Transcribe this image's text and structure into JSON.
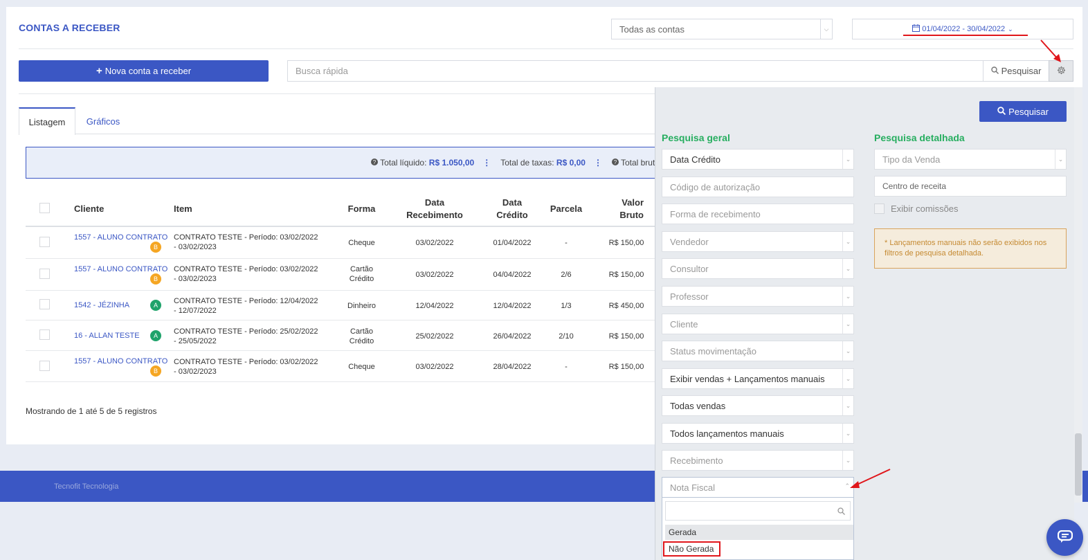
{
  "header": {
    "title": "CONTAS A RECEBER",
    "accounts_select": "Todas as contas",
    "date_range": "01/04/2022 - 30/04/2022"
  },
  "toolbar": {
    "new_button": "Nova conta a receber",
    "search_placeholder": "Busca rápida",
    "search_button": "Pesquisar"
  },
  "tabs": [
    {
      "label": "Listagem",
      "active": true
    },
    {
      "label": "Gráficos",
      "active": false
    }
  ],
  "totals": {
    "liquid_label": "Total líquido:",
    "liquid_value": "R$ 1.050,00",
    "fees_label": "Total de taxas:",
    "fees_value": "R$ 0,00",
    "gross_label": "Total bruto"
  },
  "table": {
    "headers": {
      "client": "Cliente",
      "item": "Item",
      "form": "Forma",
      "receipt_date_1": "Data",
      "receipt_date_2": "Recebimento",
      "credit_date_1": "Data",
      "credit_date_2": "Crédito",
      "installment": "Parcela",
      "gross_1": "Valor",
      "gross_2": "Bruto"
    },
    "rows": [
      {
        "client": "1557 - ALUNO CONTRATO",
        "badge": "B",
        "item": "CONTRATO TESTE - Período: 03/02/2022 - 03/02/2023",
        "form": "Cheque",
        "receipt": "03/02/2022",
        "credit": "01/04/2022",
        "installment": "-",
        "gross": "R$ 150,00"
      },
      {
        "client": "1557 - ALUNO CONTRATO",
        "badge": "B",
        "item": "CONTRATO TESTE - Período: 03/02/2022 - 03/02/2023",
        "form": "Cartão Crédito",
        "receipt": "03/02/2022",
        "credit": "04/04/2022",
        "installment": "2/6",
        "gross": "R$ 150,00"
      },
      {
        "client": "1542 - JÉZINHA",
        "badge": "A",
        "item": "CONTRATO TESTE - Período: 12/04/2022 - 12/07/2022",
        "form": "Dinheiro",
        "receipt": "12/04/2022",
        "credit": "12/04/2022",
        "installment": "1/3",
        "gross": "R$ 450,00"
      },
      {
        "client": "16 - ALLAN TESTE",
        "badge": "A",
        "item": "CONTRATO TESTE - Período: 25/02/2022 - 25/05/2022",
        "form": "Cartão Crédito",
        "receipt": "25/02/2022",
        "credit": "26/04/2022",
        "installment": "2/10",
        "gross": "R$ 150,00"
      },
      {
        "client": "1557 - ALUNO CONTRATO",
        "badge": "B",
        "item": "CONTRATO TESTE - Período: 03/02/2022 - 03/02/2023",
        "form": "Cheque",
        "receipt": "03/02/2022",
        "credit": "28/04/2022",
        "installment": "-",
        "gross": "R$ 150,00"
      }
    ],
    "footer_text": "Mostrando de 1 até 5 de 5 registros"
  },
  "footer": {
    "text": "Tecnofit Tecnologia"
  },
  "panel": {
    "search_button": "Pesquisar",
    "general_title": "Pesquisa geral",
    "detailed_title": "Pesquisa detalhada",
    "general_fields": {
      "date_credit": "Data Crédito",
      "auth_code": "Código de autorização",
      "receipt_form": "Forma de recebimento",
      "seller": "Vendedor",
      "consultant": "Consultor",
      "teacher": "Professor",
      "client": "Cliente",
      "movement_status": "Status movimentação",
      "show_sales": "Exibir vendas + Lançamentos manuais",
      "all_sales": "Todas vendas",
      "all_manual": "Todos lançamentos manuais",
      "receipt": "Recebimento",
      "invoice": "Nota Fiscal"
    },
    "detailed_fields": {
      "sale_type": "Tipo da Venda",
      "revenue_center": "Centro de receita",
      "show_commissions": "Exibir comissões"
    },
    "note": "* Lançamentos manuais não serão exibidos nos filtros de pesquisa detalhada.",
    "invoice_options": [
      "Gerada",
      "Não Gerada"
    ]
  },
  "colors": {
    "primary": "#3b57c4",
    "green": "#27ae60",
    "annotation_red": "#e0161b"
  }
}
